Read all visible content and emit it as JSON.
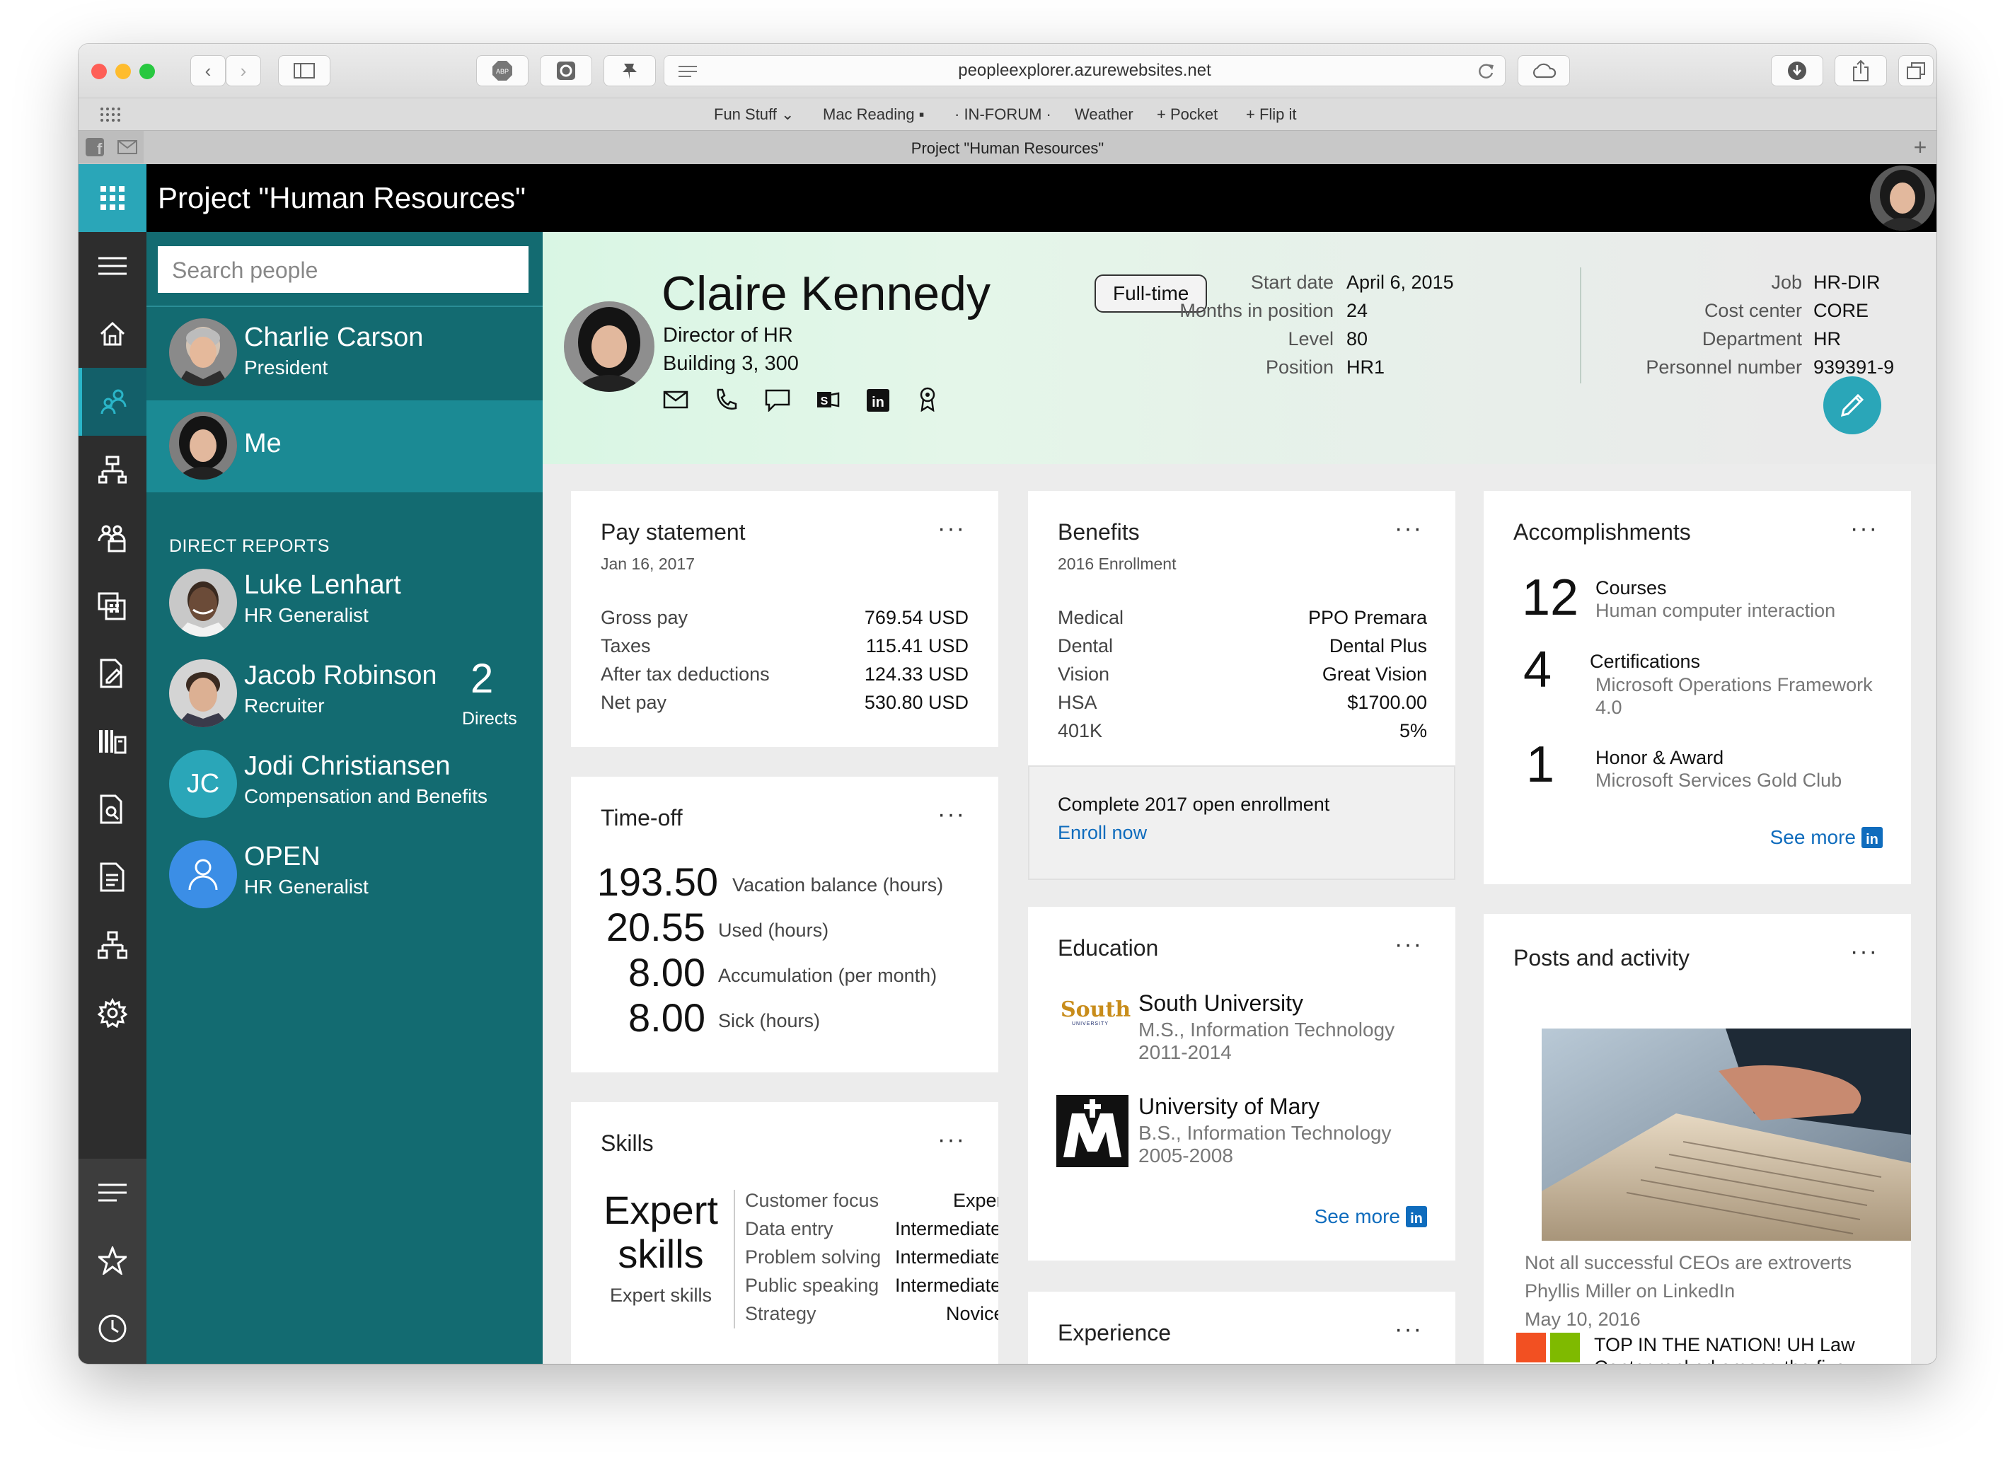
{
  "browser": {
    "url": "peopleexplorer.azurewebsites.net",
    "bookmarks": [
      "Fun Stuff ⌄",
      "Mac Reading ▪",
      "· IN-FORUM ·",
      "Weather",
      "+ Pocket",
      "+ Flip it"
    ],
    "tab_title": "Project \"Human Resources\""
  },
  "app": {
    "title": "Project \"Human Resources\""
  },
  "people": {
    "search_placeholder": "Search people",
    "manager": {
      "name": "Charlie Carson",
      "role": "President"
    },
    "me": {
      "name": "Me"
    },
    "section_label": "DIRECT REPORTS",
    "reports": [
      {
        "name": "Luke Lenhart",
        "role": "HR Generalist"
      },
      {
        "name": "Jacob Robinson",
        "role": "Recruiter",
        "count": "2",
        "count_label": "Directs"
      },
      {
        "name": "Jodi Christiansen",
        "role": "Compensation and Benefits",
        "initials": "JC"
      },
      {
        "name": "OPEN",
        "role": "HR Generalist"
      }
    ]
  },
  "profile": {
    "name": "Claire Kennedy",
    "title": "Director of HR",
    "location": "Building 3, 300",
    "badge": "Full-time",
    "fields_left": [
      {
        "label": "Start date",
        "value": "April 6, 2015"
      },
      {
        "label": "Months in position",
        "value": "24"
      },
      {
        "label": "Level",
        "value": "80"
      },
      {
        "label": "Position",
        "value": "HR1"
      }
    ],
    "fields_right": [
      {
        "label": "Job",
        "value": "HR-DIR"
      },
      {
        "label": "Cost center",
        "value": "CORE"
      },
      {
        "label": "Department",
        "value": "HR"
      },
      {
        "label": "Personnel number",
        "value": "939391-9"
      }
    ]
  },
  "pay": {
    "title": "Pay statement",
    "date": "Jan 16, 2017",
    "rows": [
      {
        "label": "Gross pay",
        "value": "769.54 USD"
      },
      {
        "label": "Taxes",
        "value": "115.41 USD"
      },
      {
        "label": "After tax deductions",
        "value": "124.33 USD"
      },
      {
        "label": "Net pay",
        "value": "530.80 USD"
      }
    ]
  },
  "timeoff": {
    "title": "Time-off",
    "rows": [
      {
        "value": "193.50",
        "label": "Vacation balance (hours)"
      },
      {
        "value": "20.55",
        "label": "Used (hours)"
      },
      {
        "value": "8.00",
        "label": "Accumulation (per month)"
      },
      {
        "value": "8.00",
        "label": "Sick (hours)"
      }
    ]
  },
  "skills": {
    "title": "Skills",
    "headline_1": "Expert",
    "headline_2": "skills",
    "headline_sub": "Expert skills",
    "rows": [
      {
        "name": "Customer focus",
        "level": "Expert"
      },
      {
        "name": "Data entry",
        "level": "Intermediate"
      },
      {
        "name": "Problem solving",
        "level": "Intermediate"
      },
      {
        "name": "Public speaking",
        "level": "Intermediate"
      },
      {
        "name": "Strategy",
        "level": "Novice"
      }
    ]
  },
  "benefits": {
    "title": "Benefits",
    "subtitle": "2016 Enrollment",
    "rows": [
      {
        "label": "Medical",
        "value": "PPO Premara"
      },
      {
        "label": "Dental",
        "value": "Dental Plus"
      },
      {
        "label": "Vision",
        "value": "Great Vision"
      },
      {
        "label": "HSA",
        "value": "$1700.00"
      },
      {
        "label": "401K",
        "value": "5%"
      }
    ],
    "cta_text": "Complete 2017 open enrollment",
    "cta_link": "Enroll now"
  },
  "education": {
    "title": "Education",
    "schools": [
      {
        "name": "South University",
        "degree": "M.S., Information Technology",
        "years": "2011-2014",
        "logo_text": "South",
        "logo_sub": "UNIVERSITY"
      },
      {
        "name": "University of Mary",
        "degree": "B.S., Information Technology",
        "years": "2005-2008"
      }
    ],
    "see_more": "See more"
  },
  "experience": {
    "title": "Experience"
  },
  "accomplishments": {
    "title": "Accomplishments",
    "rows": [
      {
        "count": "12",
        "label": "Courses",
        "detail": "Human computer interaction"
      },
      {
        "count": "4",
        "label": "Certifications",
        "detail": "Microsoft Operations Framework 4.0"
      },
      {
        "count": "1",
        "label": "Honor & Award",
        "detail": "Microsoft Services Gold Club"
      }
    ],
    "see_more": "See more"
  },
  "posts": {
    "title": "Posts and activity",
    "items": [
      {
        "headline": "Not all successful CEOs are extroverts",
        "author": "Phyllis Miller on LinkedIn",
        "date": "May 10, 2016"
      },
      {
        "headline_1": "TOP IN THE NATION! UH Law",
        "headline_2": "Center ranked among the five..."
      }
    ]
  },
  "colors": {
    "accent": "#2aa6b8",
    "sidebar": "#136b71",
    "selected": "#1b8a94",
    "link": "#0f6cbd"
  }
}
